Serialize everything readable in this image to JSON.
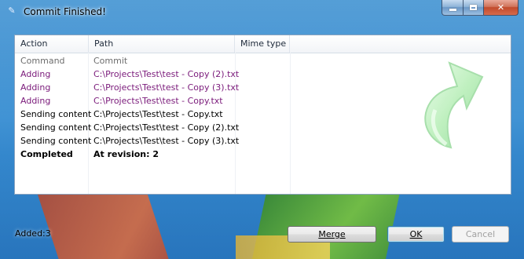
{
  "window": {
    "title": "Commit Finished!",
    "accent": "#3f95d3"
  },
  "icons": {
    "app": "tortoise-icon",
    "minimize": "minimize-icon",
    "maximize": "maximize-icon",
    "close": "close-icon",
    "arrow": "commit-arrow-icon"
  },
  "table": {
    "columns": [
      "Action",
      "Path",
      "Mime type"
    ],
    "rows": [
      {
        "action": "Command",
        "path": "Commit",
        "style": "gray"
      },
      {
        "action": "Adding",
        "path": "C:\\Projects\\Test\\test - Copy (2).txt",
        "style": "purple"
      },
      {
        "action": "Adding",
        "path": "C:\\Projects\\Test\\test - Copy (3).txt",
        "style": "purple"
      },
      {
        "action": "Adding",
        "path": "C:\\Projects\\Test\\test - Copy.txt",
        "style": "purple"
      },
      {
        "action": "Sending content",
        "path": "C:\\Projects\\Test\\test - Copy.txt",
        "style": "black"
      },
      {
        "action": "Sending content",
        "path": "C:\\Projects\\Test\\test - Copy (2).txt",
        "style": "black"
      },
      {
        "action": "Sending content",
        "path": "C:\\Projects\\Test\\test - Copy (3).txt",
        "style": "black"
      },
      {
        "action": "Completed",
        "path": "At revision: 2",
        "style": "bold"
      }
    ]
  },
  "status": {
    "text": "Added:3"
  },
  "buttons": {
    "merge": "Merge",
    "ok": "OK",
    "cancel": "Cancel"
  }
}
